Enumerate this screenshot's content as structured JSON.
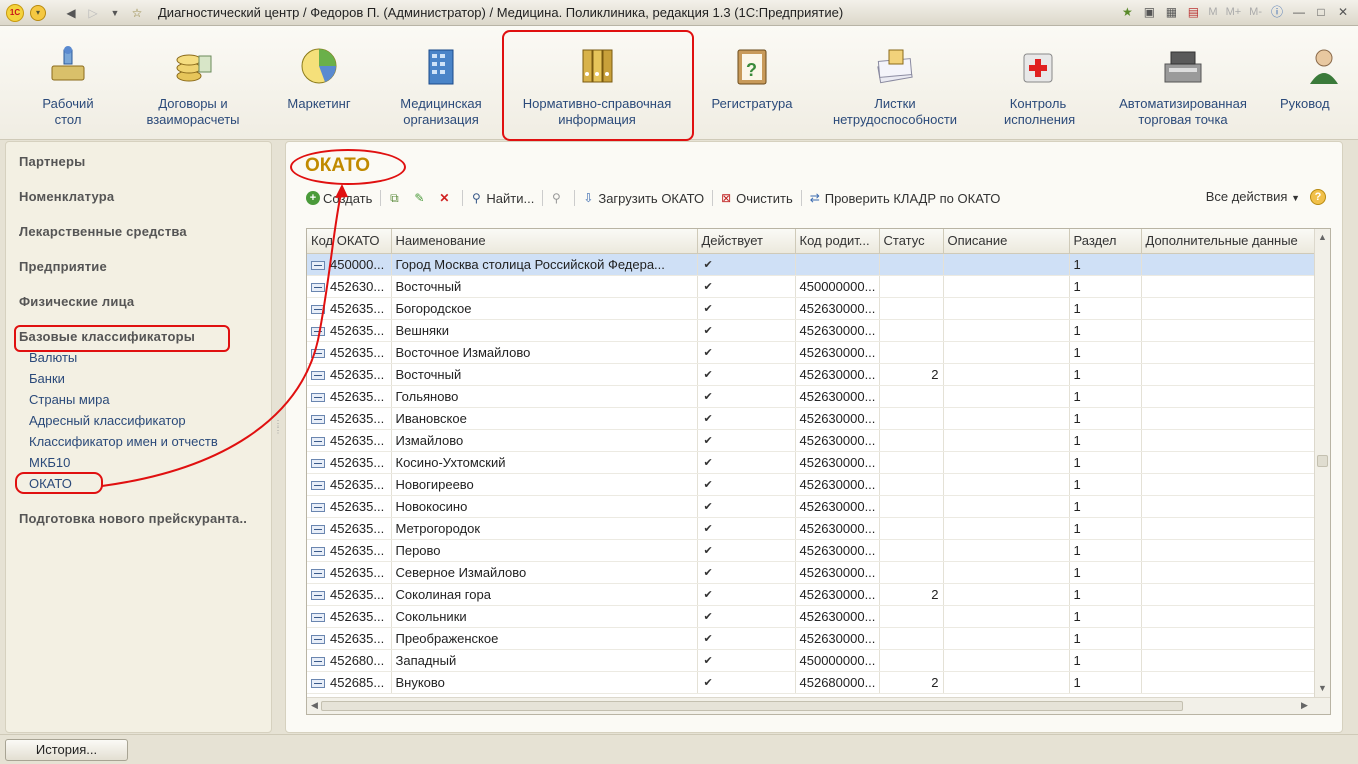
{
  "window": {
    "title": "Диагностический центр / Федоров П. (Администратор) / Медицина. Поликлиника, редакция 1.3  (1С:Предприятие)",
    "logo": "1С",
    "mem_buttons": [
      "M",
      "M+",
      "M-"
    ]
  },
  "sections": [
    {
      "name": "desktop",
      "line1": "Рабочий",
      "line2": "стол",
      "icon": "desk-icon"
    },
    {
      "name": "contracts",
      "line1": "Договоры и",
      "line2": "взаиморасчеты",
      "icon": "coins-icon"
    },
    {
      "name": "marketing",
      "line1": "Маркетинг",
      "line2": "",
      "icon": "pie-chart-icon"
    },
    {
      "name": "medorg",
      "line1": "Медицинская",
      "line2": "организация",
      "icon": "building-icon"
    },
    {
      "name": "nsi",
      "line1": "Нормативно-справочная",
      "line2": "информация",
      "icon": "binders-icon"
    },
    {
      "name": "registry",
      "line1": "Регистратура",
      "line2": "",
      "icon": "clipboard-icon"
    },
    {
      "name": "sickleave",
      "line1": "Листки",
      "line2": "нетрудоспособности",
      "icon": "sheets-icon"
    },
    {
      "name": "control",
      "line1": "Контроль",
      "line2": "исполнения",
      "icon": "firstaid-icon"
    },
    {
      "name": "pos",
      "line1": "Автоматизированная",
      "line2": "торговая точка",
      "icon": "cash-register-icon"
    },
    {
      "name": "manager",
      "line1": "Руковод",
      "line2": "",
      "icon": "person-icon"
    }
  ],
  "nav": {
    "groups": [
      "Партнеры",
      "Номенклатура",
      "Лекарственные средства",
      "Предприятие",
      "Физические лица",
      "Базовые классификаторы"
    ],
    "items": [
      "Валюты",
      "Банки",
      "Страны мира",
      "Адресный классификатор",
      "Классификатор имен и отчеств",
      "МКБ10",
      "ОКАТО"
    ],
    "last_group": "Подготовка нового прейскурантa..."
  },
  "page": {
    "title": "ОКАТО"
  },
  "toolbar": {
    "create": "Создать",
    "find": "Найти...",
    "load": "Загрузить ОКАТО",
    "clear": "Очистить",
    "check": "Проверить КЛАДР по ОКАТО",
    "all_actions": "Все действия",
    "help": "?"
  },
  "table": {
    "columns": [
      "Код ОКАТО",
      "Наименование",
      "Действует",
      "Код родит...",
      "Статус",
      "Описание",
      "Раздел",
      "Дополнительные данные"
    ],
    "rows": [
      [
        "450000...",
        "Город Москва столица Российской Федера...",
        "✔",
        "",
        "",
        "",
        "1",
        ""
      ],
      [
        "452630...",
        "Восточный",
        "✔",
        "450000000...",
        "",
        "",
        "1",
        ""
      ],
      [
        "452635...",
        "Богородское",
        "✔",
        "452630000...",
        "",
        "",
        "1",
        ""
      ],
      [
        "452635...",
        "Вешняки",
        "✔",
        "452630000...",
        "",
        "",
        "1",
        ""
      ],
      [
        "452635...",
        "Восточное Измайлово",
        "✔",
        "452630000...",
        "",
        "",
        "1",
        ""
      ],
      [
        "452635...",
        "Восточный",
        "✔",
        "452630000...",
        "2",
        "",
        "1",
        ""
      ],
      [
        "452635...",
        "Гольяново",
        "✔",
        "452630000...",
        "",
        "",
        "1",
        ""
      ],
      [
        "452635...",
        "Ивановское",
        "✔",
        "452630000...",
        "",
        "",
        "1",
        ""
      ],
      [
        "452635...",
        "Измайлово",
        "✔",
        "452630000...",
        "",
        "",
        "1",
        ""
      ],
      [
        "452635...",
        "Косино-Ухтомский",
        "✔",
        "452630000...",
        "",
        "",
        "1",
        ""
      ],
      [
        "452635...",
        "Новогиреево",
        "✔",
        "452630000...",
        "",
        "",
        "1",
        ""
      ],
      [
        "452635...",
        "Новокосино",
        "✔",
        "452630000...",
        "",
        "",
        "1",
        ""
      ],
      [
        "452635...",
        "Метрогородок",
        "✔",
        "452630000...",
        "",
        "",
        "1",
        ""
      ],
      [
        "452635...",
        "Перово",
        "✔",
        "452630000...",
        "",
        "",
        "1",
        ""
      ],
      [
        "452635...",
        "Северное Измайлово",
        "✔",
        "452630000...",
        "",
        "",
        "1",
        ""
      ],
      [
        "452635...",
        "Соколиная гора",
        "✔",
        "452630000...",
        "2",
        "",
        "1",
        ""
      ],
      [
        "452635...",
        "Сокольники",
        "✔",
        "452630000...",
        "",
        "",
        "1",
        ""
      ],
      [
        "452635...",
        "Преображенское",
        "✔",
        "452630000...",
        "",
        "",
        "1",
        ""
      ],
      [
        "452680...",
        "Западный",
        "✔",
        "450000000...",
        "",
        "",
        "1",
        ""
      ],
      [
        "452685...",
        "Внуково",
        "✔",
        "452680000...",
        "2",
        "",
        "1",
        ""
      ]
    ]
  },
  "status": {
    "history": "История..."
  },
  "colors": {
    "annotation": "#e01010",
    "title": "#c08a00",
    "link": "#2b4a7a",
    "selection": "#cfe0f6"
  }
}
